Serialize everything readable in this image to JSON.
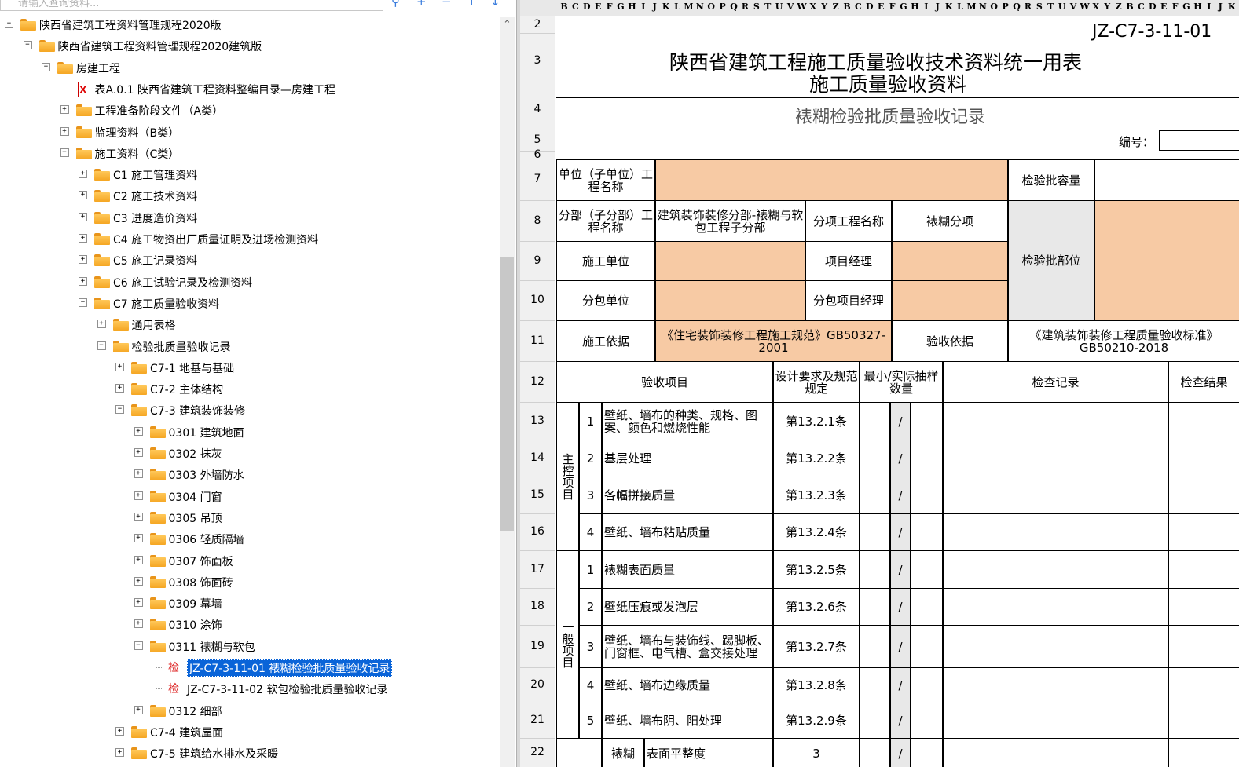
{
  "search": {
    "placeholder": "请输入查询资料..."
  },
  "tree": [
    {
      "label": "陕西省建筑工程资料管理规程2020版",
      "type": "folder",
      "toggle": "-"
    },
    {
      "label": "陕西省建筑工程资料管理规程2020建筑版",
      "type": "folder",
      "toggle": "-"
    },
    {
      "label": "房建工程",
      "type": "folder",
      "toggle": "-"
    },
    {
      "label": "表A.0.1 陕西省建筑工程资料整编目录—房建工程",
      "type": "doc",
      "toggle": ""
    },
    {
      "label": "工程准备阶段文件（A类）",
      "type": "folder",
      "toggle": "+"
    },
    {
      "label": "监理资料（B类）",
      "type": "folder",
      "toggle": "+"
    },
    {
      "label": "施工资料（C类）",
      "type": "folder",
      "toggle": "-"
    },
    {
      "label": "C1 施工管理资料",
      "type": "folder",
      "toggle": "+"
    },
    {
      "label": "C2 施工技术资料",
      "type": "folder",
      "toggle": "+"
    },
    {
      "label": "C3 进度造价资料",
      "type": "folder",
      "toggle": "+"
    },
    {
      "label": "C4 施工物资出厂质量证明及进场检测资料",
      "type": "folder",
      "toggle": "+"
    },
    {
      "label": "C5 施工记录资料",
      "type": "folder",
      "toggle": "+"
    },
    {
      "label": "C6 施工试验记录及检测资料",
      "type": "folder",
      "toggle": "+"
    },
    {
      "label": "C7 施工质量验收资料",
      "type": "folder",
      "toggle": "-"
    },
    {
      "label": "通用表格",
      "type": "folder",
      "toggle": "+"
    },
    {
      "label": "检验批质量验收记录",
      "type": "folder",
      "toggle": "-"
    },
    {
      "label": "C7-1 地基与基础",
      "type": "folder",
      "toggle": "+"
    },
    {
      "label": "C7-2 主体结构",
      "type": "folder",
      "toggle": "+"
    },
    {
      "label": "C7-3 建筑装饰装修",
      "type": "folder",
      "toggle": "-"
    },
    {
      "label": "0301 建筑地面",
      "type": "folder",
      "toggle": "+"
    },
    {
      "label": "0302 抹灰",
      "type": "folder",
      "toggle": "+"
    },
    {
      "label": "0303 外墙防水",
      "type": "folder",
      "toggle": "+"
    },
    {
      "label": "0304 门窗",
      "type": "folder",
      "toggle": "+"
    },
    {
      "label": "0305 吊顶",
      "type": "folder",
      "toggle": "+"
    },
    {
      "label": "0306 轻质隔墙",
      "type": "folder",
      "toggle": "+"
    },
    {
      "label": "0307 饰面板",
      "type": "folder",
      "toggle": "+"
    },
    {
      "label": "0308 饰面砖",
      "type": "folder",
      "toggle": "+"
    },
    {
      "label": "0309 幕墙",
      "type": "folder",
      "toggle": "+"
    },
    {
      "label": "0310 涂饰",
      "type": "folder",
      "toggle": "+"
    },
    {
      "label": "0311 裱糊与软包",
      "type": "folder",
      "toggle": "-"
    },
    {
      "label": "JZ-C7-3-11-01 裱糊检验批质量验收记录",
      "type": "check",
      "toggle": "",
      "selected": true
    },
    {
      "label": "JZ-C7-3-11-02 软包检验批质量验收记录",
      "type": "check",
      "toggle": ""
    },
    {
      "label": "0312 细部",
      "type": "folder",
      "toggle": "+"
    },
    {
      "label": "C7-4 建筑屋面",
      "type": "folder",
      "toggle": "+"
    },
    {
      "label": "C7-5 建筑给水排水及采暖",
      "type": "folder",
      "toggle": "+"
    }
  ],
  "check_glyph": "检",
  "columns": [
    "B",
    "C",
    "D",
    "E",
    "F",
    "G",
    "H",
    "I",
    "J",
    "K",
    "L",
    "M",
    "N",
    "O",
    "P",
    "Q",
    "R",
    "S",
    "T",
    "U",
    "V",
    "W",
    "X",
    "Y",
    "Z"
  ],
  "rows": [
    "2",
    "3",
    "4",
    "5",
    "6",
    "7",
    "8",
    "9",
    "10",
    "11",
    "12",
    "13",
    "14",
    "15",
    "16",
    "17",
    "18",
    "19",
    "20",
    "21",
    "22"
  ],
  "form": {
    "code": "JZ-C7-3-11-01",
    "title1": "陕西省建筑工程施工质量验收技术资料统一用表",
    "title2": "施工质量验收资料",
    "subtitle": "裱糊检验批质量验收记录",
    "number_label": "编号：",
    "unit_label": "单位（子单位）工程名称",
    "capacity_label": "检验批容量",
    "subdiv_label": "分部（子分部）工程名称",
    "subdiv_value": "建筑装饰装修分部-裱糊与软包工程子分部",
    "item_label": "分项工程名称",
    "item_value": "裱糊分项",
    "builder_label": "施工单位",
    "pm_label": "项目经理",
    "part_label": "检验批部位",
    "sub_label": "分包单位",
    "sub_pm_label": "分包项目经理",
    "basis_label": "施工依据",
    "basis_value": "《住宅装饰装修工程施工规范》GB50327-2001",
    "acc_basis_label": "验收依据",
    "acc_basis_value": "《建筑装饰装修工程质量验收标准》GB50210-2018",
    "h_item": "验收项目",
    "h_design": "设计要求及规范规定",
    "h_sample": "最小/实际抽样数量",
    "h_record": "检查记录",
    "h_result": "检查结果",
    "main_group": "主控项目",
    "general_group": "一般项目",
    "main_items": [
      {
        "no": "1",
        "name": "壁纸、墙布的种类、规格、图案、颜色和燃烧性能",
        "clause": "第13.2.1条"
      },
      {
        "no": "2",
        "name": "基层处理",
        "clause": "第13.2.2条"
      },
      {
        "no": "3",
        "name": "各幅拼接质量",
        "clause": "第13.2.3条"
      },
      {
        "no": "4",
        "name": "壁纸、墙布粘贴质量",
        "clause": "第13.2.4条"
      }
    ],
    "general_items": [
      {
        "no": "1",
        "name": "裱糊表面质量",
        "clause": "第13.2.5条"
      },
      {
        "no": "2",
        "name": "壁纸压痕或发泡层",
        "clause": "第13.2.6条"
      },
      {
        "no": "3",
        "name": "壁纸、墙布与装饰线、踢脚板、门窗框、电气槽、盒交接处理",
        "clause": "第13.2.7条"
      },
      {
        "no": "4",
        "name": "壁纸、墙布边缘质量",
        "clause": "第13.2.8条"
      },
      {
        "no": "5",
        "name": "壁纸、墙布阴、阳处理",
        "clause": "第13.2.9条"
      }
    ],
    "last_group": "裱糊",
    "last_name": "表面平整度",
    "last_value": "3",
    "slash": "/"
  }
}
